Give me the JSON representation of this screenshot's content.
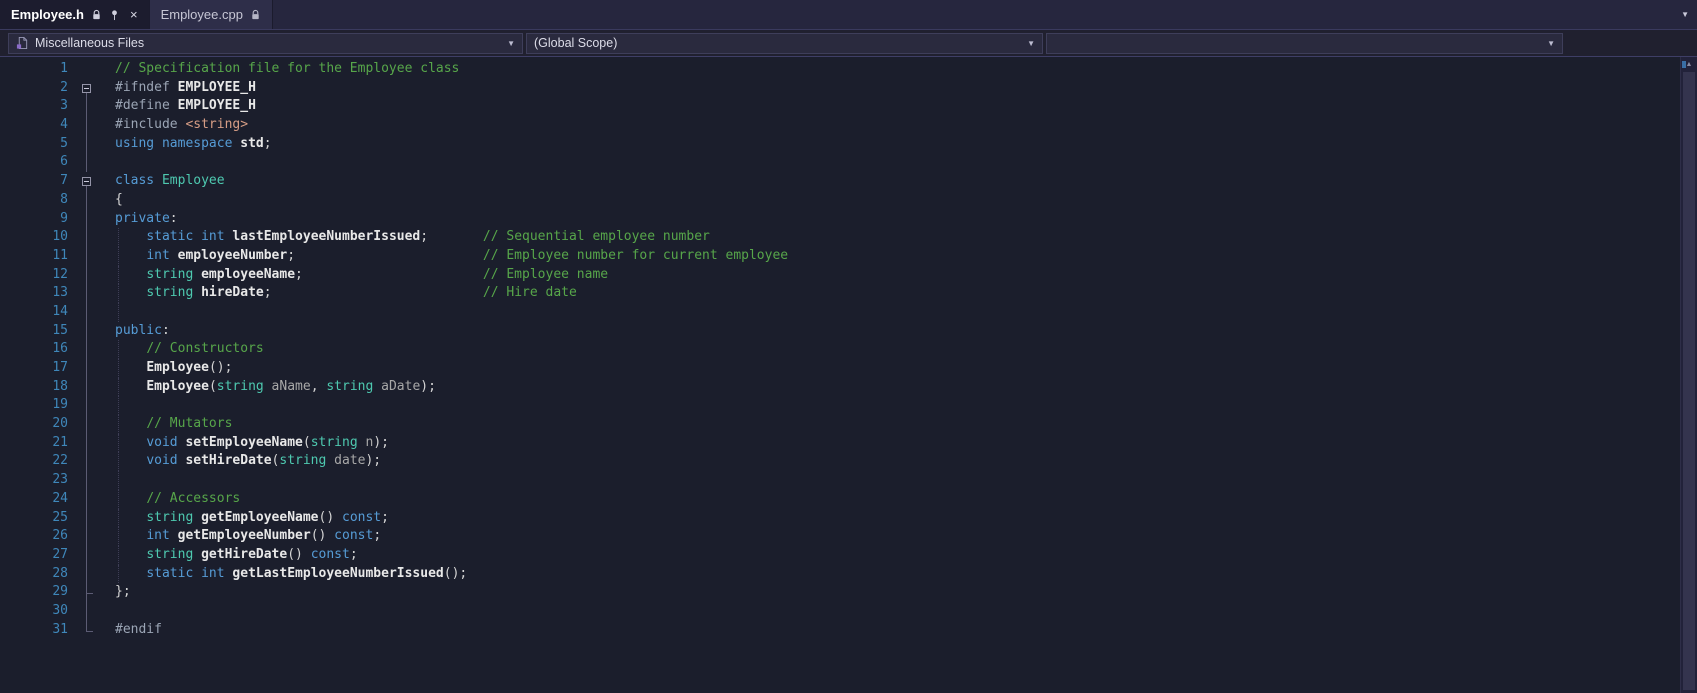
{
  "colors": {
    "editor_bg": "#1b1e2c",
    "tabstrip_bg": "#26263e",
    "active_tab_bg": "#1c1c2e",
    "inactive_tab_bg": "#2e2e49",
    "navbar_bg": "#20202f",
    "combo_bg": "#2a2a3e",
    "line_number": "#3f87ba",
    "comment": "#57a64a",
    "keyword": "#569cd6",
    "type": "#4ec9b0",
    "preprocessor": "#9ba5b5",
    "identifier": "#e8e8e8",
    "parameter": "#a8a8a8",
    "string_literal": "#d69d85"
  },
  "icons": {
    "lock": "lock-icon",
    "pin": "pin-icon",
    "file": "file-icon",
    "close_glyph": "×",
    "chevron_down_glyph": "▼",
    "scroll_up_glyph": "▲"
  },
  "tabs": [
    {
      "label": "Employee.h",
      "active": true,
      "pinned": true,
      "readonly": true
    },
    {
      "label": "Employee.cpp",
      "active": false,
      "readonly": true
    }
  ],
  "navbar": {
    "project_dropdown": "Miscellaneous Files",
    "scope_dropdown": "(Global Scope)",
    "member_dropdown": ""
  },
  "editor": {
    "language": "C++",
    "lines": [
      {
        "n": 1,
        "m": "none",
        "g": false,
        "t": [
          [
            "cm",
            "// Specification file for the Employee class"
          ]
        ]
      },
      {
        "n": 2,
        "m": "box",
        "g": false,
        "t": [
          [
            "pp",
            "#ifndef "
          ],
          [
            "def",
            "EMPLOYEE_H"
          ]
        ]
      },
      {
        "n": 3,
        "m": "line",
        "g": false,
        "t": [
          [
            "pp",
            "#define "
          ],
          [
            "def",
            "EMPLOYEE_H"
          ]
        ]
      },
      {
        "n": 4,
        "m": "line",
        "g": false,
        "t": [
          [
            "pp",
            "#include "
          ],
          [
            "str",
            "<string>"
          ]
        ]
      },
      {
        "n": 5,
        "m": "line",
        "g": false,
        "t": [
          [
            "kw",
            "using"
          ],
          [
            "pl",
            " "
          ],
          [
            "kw",
            "namespace"
          ],
          [
            "pl",
            " "
          ],
          [
            "def",
            "std"
          ],
          [
            "pl",
            ";"
          ]
        ]
      },
      {
        "n": 6,
        "m": "line",
        "g": false,
        "t": []
      },
      {
        "n": 7,
        "m": "box",
        "g": false,
        "t": [
          [
            "kw",
            "class"
          ],
          [
            "pl",
            " "
          ],
          [
            "ty",
            "Employee"
          ]
        ]
      },
      {
        "n": 8,
        "m": "line",
        "g": false,
        "t": [
          [
            "pl",
            "{"
          ]
        ]
      },
      {
        "n": 9,
        "m": "line",
        "g": false,
        "t": [
          [
            "kw",
            "private"
          ],
          [
            "pl",
            ":"
          ]
        ]
      },
      {
        "n": 10,
        "m": "line",
        "g": true,
        "t": [
          [
            "pl",
            "    "
          ],
          [
            "kw",
            "static"
          ],
          [
            "pl",
            " "
          ],
          [
            "kw",
            "int"
          ],
          [
            "pl",
            " "
          ],
          [
            "def",
            "lastEmployeeNumberIssued"
          ],
          [
            "pl",
            ";       "
          ],
          [
            "cm",
            "// Sequential employee number"
          ]
        ]
      },
      {
        "n": 11,
        "m": "line",
        "g": true,
        "t": [
          [
            "pl",
            "    "
          ],
          [
            "kw",
            "int"
          ],
          [
            "pl",
            " "
          ],
          [
            "def",
            "employeeNumber"
          ],
          [
            "pl",
            ";                        "
          ],
          [
            "cm",
            "// Employee number for current employee"
          ]
        ]
      },
      {
        "n": 12,
        "m": "line",
        "g": true,
        "t": [
          [
            "pl",
            "    "
          ],
          [
            "ty",
            "string"
          ],
          [
            "pl",
            " "
          ],
          [
            "def",
            "employeeName"
          ],
          [
            "pl",
            ";                       "
          ],
          [
            "cm",
            "// Employee name"
          ]
        ]
      },
      {
        "n": 13,
        "m": "line",
        "g": true,
        "t": [
          [
            "pl",
            "    "
          ],
          [
            "ty",
            "string"
          ],
          [
            "pl",
            " "
          ],
          [
            "def",
            "hireDate"
          ],
          [
            "pl",
            ";                           "
          ],
          [
            "cm",
            "// Hire date"
          ]
        ]
      },
      {
        "n": 14,
        "m": "line",
        "g": true,
        "t": []
      },
      {
        "n": 15,
        "m": "line",
        "g": false,
        "t": [
          [
            "kw",
            "public"
          ],
          [
            "pl",
            ":"
          ]
        ]
      },
      {
        "n": 16,
        "m": "line",
        "g": true,
        "t": [
          [
            "pl",
            "    "
          ],
          [
            "cm",
            "// Constructors"
          ]
        ]
      },
      {
        "n": 17,
        "m": "line",
        "g": true,
        "t": [
          [
            "pl",
            "    "
          ],
          [
            "def",
            "Employee"
          ],
          [
            "pl",
            "();"
          ]
        ]
      },
      {
        "n": 18,
        "m": "line",
        "g": true,
        "t": [
          [
            "pl",
            "    "
          ],
          [
            "def",
            "Employee"
          ],
          [
            "pl",
            "("
          ],
          [
            "ty",
            "string"
          ],
          [
            "pa",
            " aName"
          ],
          [
            "pl",
            ", "
          ],
          [
            "ty",
            "string"
          ],
          [
            "pa",
            " aDate"
          ],
          [
            "pl",
            ");"
          ]
        ]
      },
      {
        "n": 19,
        "m": "line",
        "g": true,
        "t": []
      },
      {
        "n": 20,
        "m": "line",
        "g": true,
        "t": [
          [
            "pl",
            "    "
          ],
          [
            "cm",
            "// Mutators"
          ]
        ]
      },
      {
        "n": 21,
        "m": "line",
        "g": true,
        "t": [
          [
            "pl",
            "    "
          ],
          [
            "kw",
            "void"
          ],
          [
            "pl",
            " "
          ],
          [
            "def",
            "setEmployeeName"
          ],
          [
            "pl",
            "("
          ],
          [
            "ty",
            "string"
          ],
          [
            "pa",
            " n"
          ],
          [
            "pl",
            ");"
          ]
        ]
      },
      {
        "n": 22,
        "m": "line",
        "g": true,
        "t": [
          [
            "pl",
            "    "
          ],
          [
            "kw",
            "void"
          ],
          [
            "pl",
            " "
          ],
          [
            "def",
            "setHireDate"
          ],
          [
            "pl",
            "("
          ],
          [
            "ty",
            "string"
          ],
          [
            "pa",
            " date"
          ],
          [
            "pl",
            ");"
          ]
        ]
      },
      {
        "n": 23,
        "m": "line",
        "g": true,
        "t": []
      },
      {
        "n": 24,
        "m": "line",
        "g": true,
        "t": [
          [
            "pl",
            "    "
          ],
          [
            "cm",
            "// Accessors"
          ]
        ]
      },
      {
        "n": 25,
        "m": "line",
        "g": true,
        "t": [
          [
            "pl",
            "    "
          ],
          [
            "ty",
            "string"
          ],
          [
            "pl",
            " "
          ],
          [
            "def",
            "getEmployeeName"
          ],
          [
            "pl",
            "() "
          ],
          [
            "kw",
            "const"
          ],
          [
            "pl",
            ";"
          ]
        ]
      },
      {
        "n": 26,
        "m": "line",
        "g": true,
        "t": [
          [
            "pl",
            "    "
          ],
          [
            "kw",
            "int"
          ],
          [
            "pl",
            " "
          ],
          [
            "def",
            "getEmployeeNumber"
          ],
          [
            "pl",
            "() "
          ],
          [
            "kw",
            "const"
          ],
          [
            "pl",
            ";"
          ]
        ]
      },
      {
        "n": 27,
        "m": "line",
        "g": true,
        "t": [
          [
            "pl",
            "    "
          ],
          [
            "ty",
            "string"
          ],
          [
            "pl",
            " "
          ],
          [
            "def",
            "getHireDate"
          ],
          [
            "pl",
            "() "
          ],
          [
            "kw",
            "const"
          ],
          [
            "pl",
            ";"
          ]
        ]
      },
      {
        "n": 28,
        "m": "line",
        "g": true,
        "t": [
          [
            "pl",
            "    "
          ],
          [
            "kw",
            "static"
          ],
          [
            "pl",
            " "
          ],
          [
            "kw",
            "int"
          ],
          [
            "pl",
            " "
          ],
          [
            "def",
            "getLastEmployeeNumberIssued"
          ],
          [
            "pl",
            "();"
          ]
        ]
      },
      {
        "n": 29,
        "m": "tickline",
        "g": false,
        "t": [
          [
            "pl",
            "};"
          ]
        ]
      },
      {
        "n": 30,
        "m": "line",
        "g": false,
        "t": []
      },
      {
        "n": 31,
        "m": "tick",
        "g": false,
        "t": [
          [
            "pp",
            "#endif"
          ]
        ]
      }
    ]
  }
}
